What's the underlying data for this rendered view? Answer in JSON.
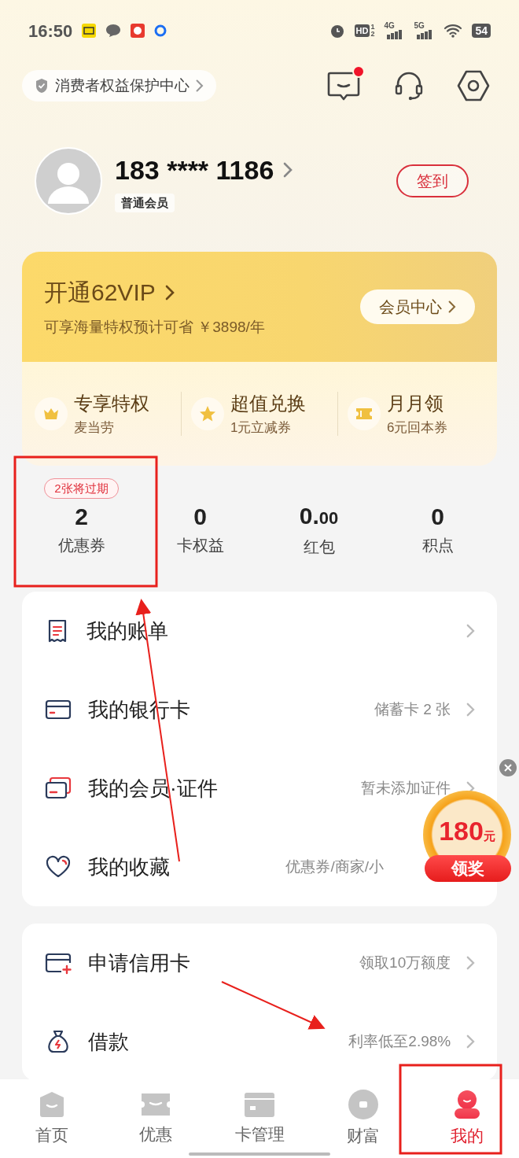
{
  "status_bar": {
    "time": "16:50",
    "hd": "HD",
    "hd_sub": [
      "1",
      "2"
    ],
    "signals": [
      "4G",
      "5G"
    ],
    "battery": "54"
  },
  "header": {
    "consumer_link": "消费者权益保护中心",
    "message_unread": true
  },
  "profile": {
    "phone": "183 **** 1186",
    "level": "普通会员",
    "checkin": "签到"
  },
  "vip": {
    "title": "开通62VIP",
    "subtitle": "可享海量特权预计可省 ￥3898/年",
    "center": "会员中心",
    "perks": [
      {
        "title": "专享特权",
        "sub": "麦当劳"
      },
      {
        "title": "超值兑换",
        "sub": "1元立减券"
      },
      {
        "title": "月月领",
        "sub": "6元回本券"
      }
    ]
  },
  "stats": [
    {
      "value": "2",
      "label": "优惠券",
      "badge": "2张将过期"
    },
    {
      "value": "0",
      "label": "卡权益"
    },
    {
      "value": "0.",
      "decimals": "00",
      "label": "红包"
    },
    {
      "value": "0",
      "label": "积点"
    }
  ],
  "menu_groups": [
    [
      {
        "label": "我的账单"
      },
      {
        "label": "我的银行卡",
        "hint": "储蓄卡 2 张"
      },
      {
        "label": "我的会员·证件",
        "hint": "暂未添加证件"
      },
      {
        "label": "我的收藏",
        "hint": "优惠券/商家/小"
      }
    ],
    [
      {
        "label": "申请信用卡",
        "hint": "领取10万额度"
      },
      {
        "label": "借款",
        "hint": "利率低至2.98%"
      }
    ]
  ],
  "float_reward": {
    "amount": "180",
    "unit": "元",
    "action": "领奖"
  },
  "nav": [
    {
      "label": "首页",
      "selected": false
    },
    {
      "label": "优惠",
      "selected": false
    },
    {
      "label": "卡管理",
      "selected": false
    },
    {
      "label": "财富",
      "selected": false
    },
    {
      "label": "我的",
      "selected": true
    }
  ]
}
